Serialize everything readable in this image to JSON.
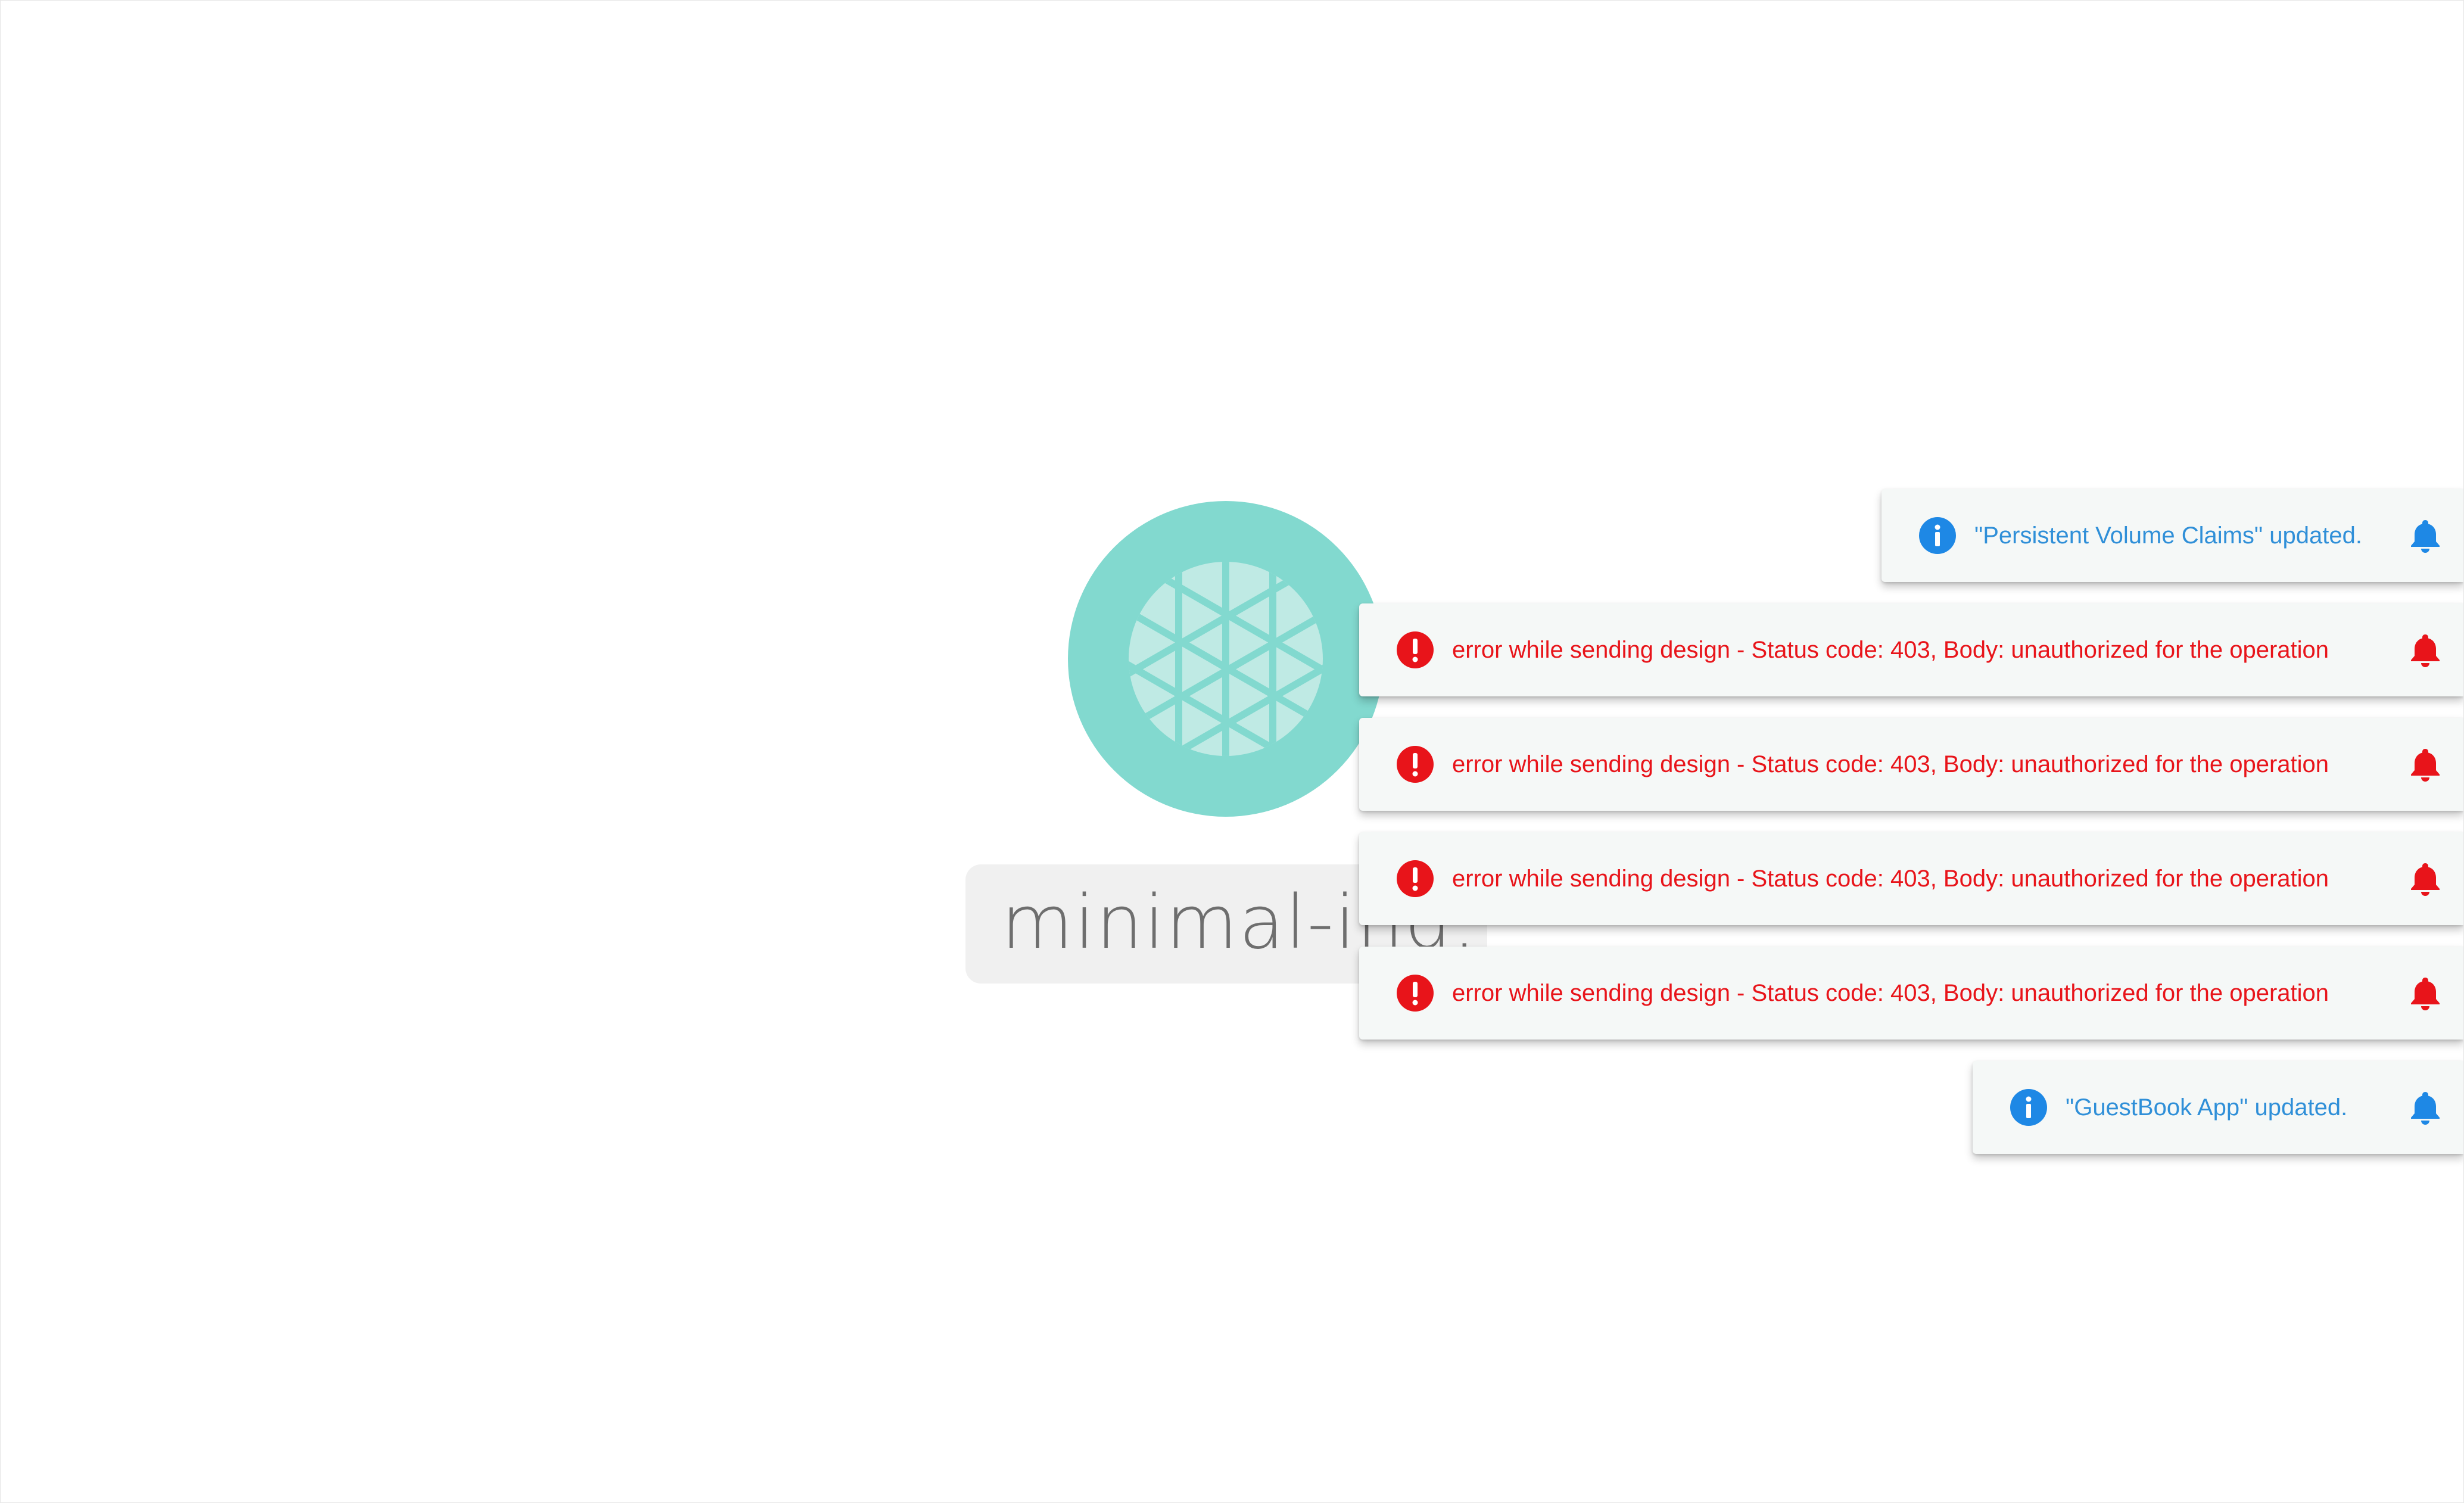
{
  "node": {
    "label": "minimal-ind...",
    "icon": "design-pattern-icon",
    "colors": {
      "circle": "#82d9cf",
      "pattern": "#bfeae4",
      "label_bg": "#f0f0f0",
      "label_text": "#6e6e6e"
    }
  },
  "notifications": [
    {
      "type": "info",
      "message": "\"Persistent Volume Claims\" updated.",
      "icon": "info-icon",
      "action_icon": "bell-icon"
    },
    {
      "type": "error",
      "message": "error while sending design - Status code: 403, Body: unauthorized for the operation",
      "icon": "error-icon",
      "action_icon": "bell-icon"
    },
    {
      "type": "error",
      "message": "error while sending design - Status code: 403, Body: unauthorized for the operation",
      "icon": "error-icon",
      "action_icon": "bell-icon"
    },
    {
      "type": "error",
      "message": "error while sending design - Status code: 403, Body: unauthorized for the operation",
      "icon": "error-icon",
      "action_icon": "bell-icon"
    },
    {
      "type": "error",
      "message": "error while sending design - Status code: 403, Body: unauthorized for the operation",
      "icon": "error-icon",
      "action_icon": "bell-icon"
    },
    {
      "type": "info",
      "message": "\"GuestBook App\" updated.",
      "icon": "info-icon",
      "action_icon": "bell-icon"
    }
  ],
  "colors": {
    "info": "#2f8fd8",
    "info_icon": "#1e88e5",
    "error": "#e8141a",
    "toast_bg": "#f5f8f7"
  }
}
